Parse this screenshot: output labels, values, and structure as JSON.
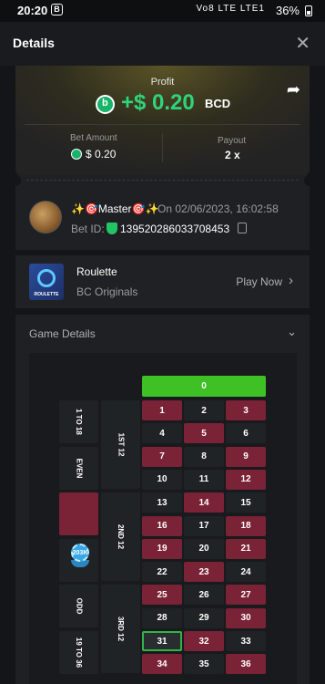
{
  "status_bar": {
    "time": "20:20",
    "badge": "B",
    "network": "Vo8 LTE LTE1",
    "battery": "36%"
  },
  "header": {
    "title": "Details",
    "close": "✕"
  },
  "profit": {
    "label": "Profit",
    "amount": "+$ 0.20",
    "currency": "BCD",
    "bet_amount_label": "Bet Amount",
    "bet_amount": "$ 0.20",
    "payout_label": "Payout",
    "payout": "2 x",
    "accent": "#2fd47a"
  },
  "bet": {
    "user": "✨🎯Master🎯✨",
    "date": "On 02/06/2023, 16:02:58",
    "bet_id_label": "Bet ID:",
    "bet_id": "139520286033708453"
  },
  "game": {
    "name": "Roulette",
    "provider": "BC Originals",
    "thumb_text": "ROULETTE",
    "play_label": "Play Now"
  },
  "details": {
    "title": "Game Details"
  },
  "board": {
    "zero": "0",
    "rows": [
      [
        "1",
        "2",
        "3"
      ],
      [
        "4",
        "5",
        "6"
      ],
      [
        "7",
        "8",
        "9"
      ],
      [
        "10",
        "11",
        "12"
      ],
      [
        "13",
        "14",
        "15"
      ],
      [
        "16",
        "17",
        "18"
      ],
      [
        "19",
        "20",
        "21"
      ],
      [
        "22",
        "23",
        "24"
      ],
      [
        "25",
        "26",
        "27"
      ],
      [
        "28",
        "29",
        "30"
      ],
      [
        "31",
        "32",
        "33"
      ],
      [
        "34",
        "35",
        "36"
      ]
    ],
    "red_numbers": [
      "1",
      "3",
      "5",
      "7",
      "9",
      "12",
      "14",
      "16",
      "18",
      "19",
      "21",
      "23",
      "25",
      "27",
      "30",
      "32",
      "34",
      "36"
    ],
    "selected": "31",
    "dozens": [
      "1ST 12",
      "2ND 12",
      "3RD 12"
    ],
    "outside": [
      "1 TO 18",
      "EVEN",
      "",
      "",
      "ODD",
      "19 TO 36"
    ],
    "chip_label": "203K",
    "colors": {
      "red": "#7a2236",
      "black": "#202326",
      "zero": "#3fc126"
    }
  }
}
